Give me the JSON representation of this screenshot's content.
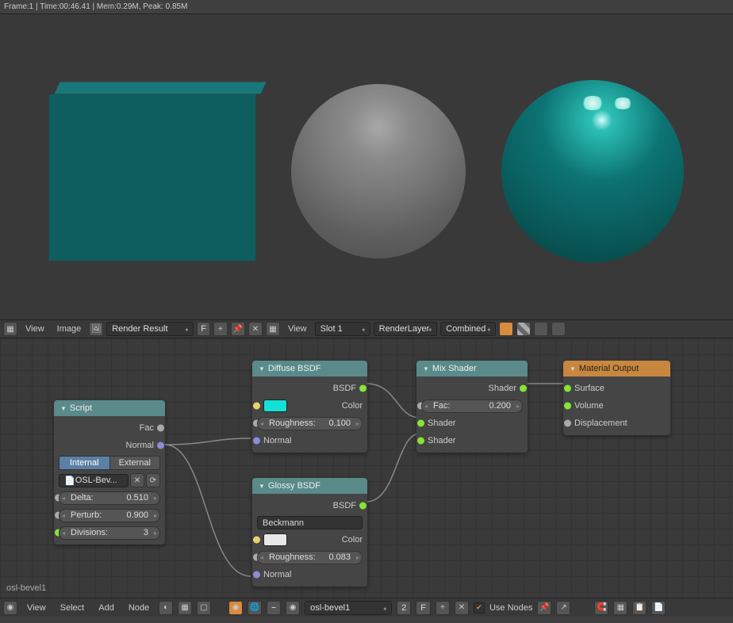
{
  "info_bar": "Frame:1 | Time:00:46.41 | Mem:0.29M, Peak: 0.85M",
  "image_toolbar": {
    "view": "View",
    "image": "Image",
    "render_result": "Render Result",
    "f_label": "F",
    "view2": "View",
    "slot": "Slot 1",
    "layer": "RenderLayer",
    "pass": "Combined"
  },
  "material_name": "osl-bevel1",
  "node_toolbar": {
    "view": "View",
    "select": "Select",
    "add": "Add",
    "node": "Node",
    "material": "osl-bevel1",
    "slot_num": "2",
    "f_label": "F",
    "use_nodes": "Use Nodes"
  },
  "nodes": {
    "script": {
      "title": "Script",
      "out_fac": "Fac",
      "out_normal": "Normal",
      "seg_internal": "Internal",
      "seg_external": "External",
      "file": "OSL-Bev...",
      "delta": {
        "label": "Delta:",
        "value": "0.510"
      },
      "perturb": {
        "label": "Perturb:",
        "value": "0.900"
      },
      "divisions": {
        "label": "Divisions:",
        "value": "3"
      }
    },
    "diffuse": {
      "title": "Diffuse BSDF",
      "out": "BSDF",
      "color_label": "Color",
      "color_hex": "#13e0d6",
      "roughness": {
        "label": "Roughness:",
        "value": "0.100"
      },
      "normal": "Normal"
    },
    "glossy": {
      "title": "Glossy BSDF",
      "out": "BSDF",
      "dist": "Beckmann",
      "color_label": "Color",
      "color_hex": "#e8e8e8",
      "roughness": {
        "label": "Roughness:",
        "value": "0.083"
      },
      "normal": "Normal"
    },
    "mix": {
      "title": "Mix Shader",
      "out": "Shader",
      "fac": {
        "label": "Fac:",
        "value": "0.200"
      },
      "in1": "Shader",
      "in2": "Shader"
    },
    "output": {
      "title": "Material Output",
      "surface": "Surface",
      "volume": "Volume",
      "displacement": "Displacement"
    }
  }
}
